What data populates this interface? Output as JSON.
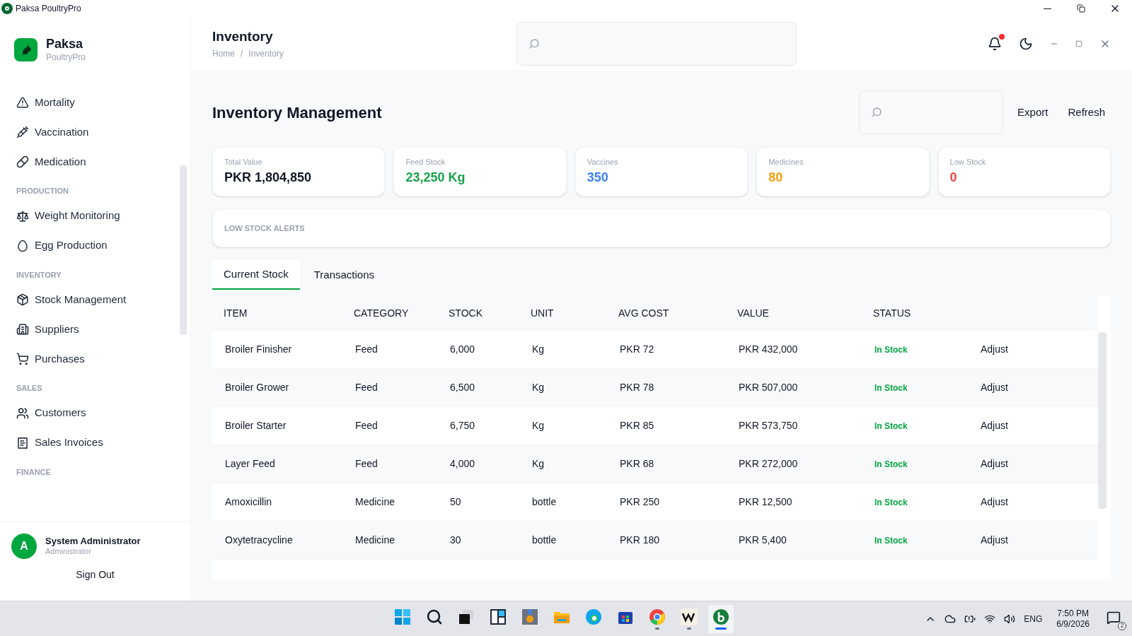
{
  "window": {
    "title": "Paksa PoultryPro"
  },
  "brand": {
    "name": "Paksa",
    "subtitle": "PoultryPro"
  },
  "sidebar": {
    "sections": [
      {
        "items": [
          {
            "label": "Mortality"
          },
          {
            "label": "Vaccination"
          },
          {
            "label": "Medication"
          }
        ]
      },
      {
        "heading": "PRODUCTION",
        "items": [
          {
            "label": "Weight Monitoring"
          },
          {
            "label": "Egg Production"
          }
        ]
      },
      {
        "heading": "INVENTORY",
        "items": [
          {
            "label": "Stock Management"
          },
          {
            "label": "Suppliers"
          },
          {
            "label": "Purchases"
          }
        ]
      },
      {
        "heading": "SALES",
        "items": [
          {
            "label": "Customers"
          },
          {
            "label": "Sales Invoices"
          }
        ]
      },
      {
        "heading": "FINANCE"
      }
    ]
  },
  "user": {
    "initial": "A",
    "name": "System Administrator",
    "role": "Administrator",
    "sign_out": "Sign Out"
  },
  "header": {
    "title": "Inventory",
    "breadcrumb": [
      "Home",
      "Inventory"
    ],
    "breadcrumb_separator": "/",
    "unread_notifications": true
  },
  "page": {
    "title": "Inventory Management",
    "actions": [
      "Export",
      "Refresh"
    ]
  },
  "stats": [
    {
      "label": "Total Value",
      "value": "PKR 1,804,850",
      "color": "#111827"
    },
    {
      "label": "Feed Stock",
      "value": "23,250 Kg",
      "color": "#16a34a"
    },
    {
      "label": "Vaccines",
      "value": "350",
      "color": "#3b82f6"
    },
    {
      "label": "Medicines",
      "value": "80",
      "color": "#f59e0b"
    },
    {
      "label": "Low Stock",
      "value": "0",
      "color": "#ef4444"
    }
  ],
  "alerts": {
    "title": "LOW STOCK ALERTS"
  },
  "tabs": [
    {
      "label": "Current Stock",
      "selected": true
    },
    {
      "label": "Transactions",
      "selected": false
    }
  ],
  "table": {
    "columns": [
      "ITEM",
      "CATEGORY",
      "STOCK",
      "UNIT",
      "AVG COST",
      "VALUE",
      "STATUS"
    ],
    "rows": [
      {
        "cells": [
          "Broiler Finisher",
          "Feed",
          "6,000",
          "Kg",
          "PKR 72",
          "PKR 432,000",
          "In Stock"
        ],
        "action": "Adjust"
      },
      {
        "cells": [
          "Broiler Grower",
          "Feed",
          "6,500",
          "Kg",
          "PKR 78",
          "PKR 507,000",
          "In Stock"
        ],
        "action": "Adjust"
      },
      {
        "cells": [
          "Broiler Starter",
          "Feed",
          "6,750",
          "Kg",
          "PKR 85",
          "PKR 573,750",
          "In Stock"
        ],
        "action": "Adjust"
      },
      {
        "cells": [
          "Layer Feed",
          "Feed",
          "4,000",
          "Kg",
          "PKR 68",
          "PKR 272,000",
          "In Stock"
        ],
        "action": "Adjust"
      },
      {
        "cells": [
          "Amoxicillin",
          "Medicine",
          "50",
          "bottle",
          "PKR 250",
          "PKR 12,500",
          "In Stock"
        ],
        "action": "Adjust"
      },
      {
        "cells": [
          "Oxytetracycline",
          "Medicine",
          "30",
          "bottle",
          "PKR 180",
          "PKR 5,400",
          "In Stock"
        ],
        "action": "Adjust"
      }
    ]
  },
  "taskbar": {
    "apps": [
      {
        "kind": "start",
        "running": false,
        "selected": false
      },
      {
        "kind": "search",
        "running": false,
        "selected": false
      },
      {
        "kind": "taskview",
        "running": false,
        "selected": false
      },
      {
        "kind": "widgets",
        "running": false,
        "selected": false
      },
      {
        "kind": "medal",
        "running": false,
        "selected": false
      },
      {
        "kind": "folder",
        "running": false,
        "selected": false
      },
      {
        "kind": "edge",
        "running": false,
        "selected": false
      },
      {
        "kind": "store",
        "running": false,
        "selected": false
      },
      {
        "kind": "chrome",
        "running": true,
        "selected": false
      },
      {
        "kind": "wave",
        "running": true,
        "selected": false
      },
      {
        "kind": "paksa",
        "running": true,
        "selected": true
      }
    ],
    "language": "ENG",
    "time": "7:50 PM",
    "date": "6/9/2026",
    "notification_count": "2"
  }
}
